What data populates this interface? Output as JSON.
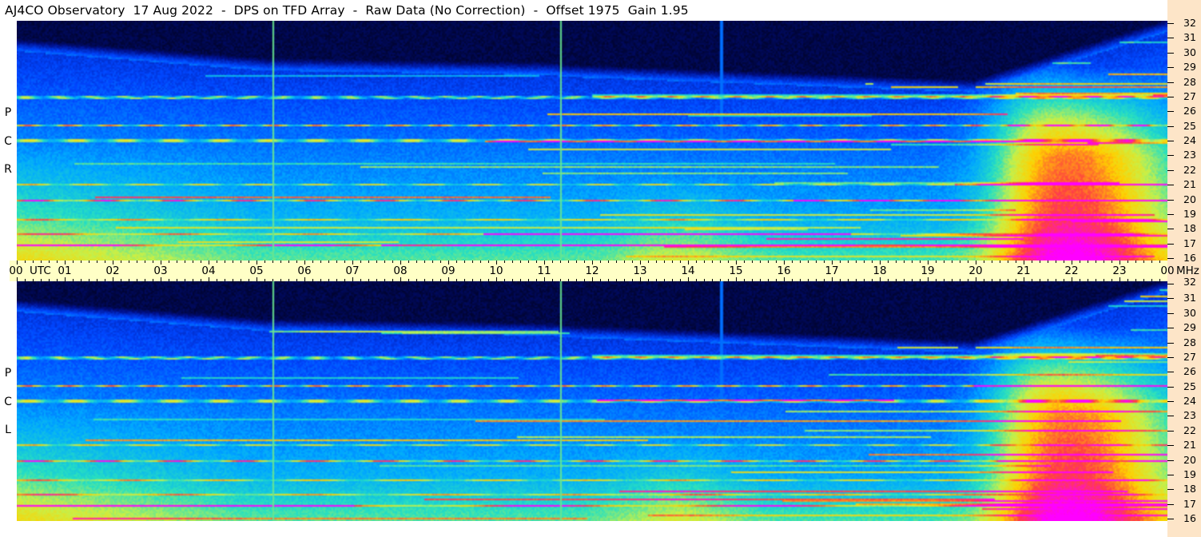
{
  "header": {
    "title": "AJ4CO Observatory  17 Aug 2022  -  DPS on TFD Array  -  Raw Data (No Correction)  -  Offset 1975  Gain 1.95"
  },
  "panels": [
    {
      "polarization_label": [
        "P",
        "C",
        "R"
      ]
    },
    {
      "polarization_label": [
        "P",
        "C",
        "L"
      ]
    }
  ],
  "time_axis": {
    "hours": [
      "00",
      "01",
      "02",
      "03",
      "04",
      "05",
      "06",
      "07",
      "08",
      "09",
      "10",
      "11",
      "12",
      "13",
      "14",
      "15",
      "16",
      "17",
      "18",
      "19",
      "20",
      "21",
      "22",
      "23",
      "00"
    ],
    "utc_label": "UTC",
    "mhz_label": "MHz"
  },
  "freq_axis": {
    "labels": [
      "32",
      "31",
      "30",
      "29",
      "28",
      "27",
      "26",
      "25",
      "24",
      "23",
      "22",
      "21",
      "20",
      "19",
      "18",
      "17",
      "16"
    ]
  },
  "chart_data": {
    "type": "heatmap",
    "title": "AJ4CO Observatory  17 Aug 2022  -  DPS on TFD Array  -  Raw Data (No Correction)  -  Offset 1975  Gain 1.95",
    "x": {
      "label": "UTC",
      "range": [
        "00",
        "00"
      ],
      "ticks": [
        "00",
        "01",
        "02",
        "03",
        "04",
        "05",
        "06",
        "07",
        "08",
        "09",
        "10",
        "11",
        "12",
        "13",
        "14",
        "15",
        "16",
        "17",
        "18",
        "19",
        "20",
        "21",
        "22",
        "23",
        "00"
      ]
    },
    "y": {
      "label": "MHz",
      "range": [
        16,
        32
      ],
      "ticks": [
        16,
        17,
        18,
        19,
        20,
        21,
        22,
        23,
        24,
        25,
        26,
        27,
        28,
        29,
        30,
        31,
        32
      ]
    },
    "panels": [
      "RCP",
      "LCP"
    ],
    "colormap": [
      "#000014",
      "#00108c",
      "#0046ff",
      "#00a8ff",
      "#28e0c0",
      "#c8f048",
      "#ffd000",
      "#ff4040",
      "#ff00ff"
    ],
    "notes": {
      "vertical_calibration_lines_utc": [
        5.35,
        11.35
      ],
      "vertical_interference_line_utc": 14.7,
      "strong_noise_bands_mhz": [
        17.0,
        17.7,
        18.7,
        20.0,
        21.0,
        24.0,
        25.0,
        26.8,
        27.0
      ]
    }
  }
}
